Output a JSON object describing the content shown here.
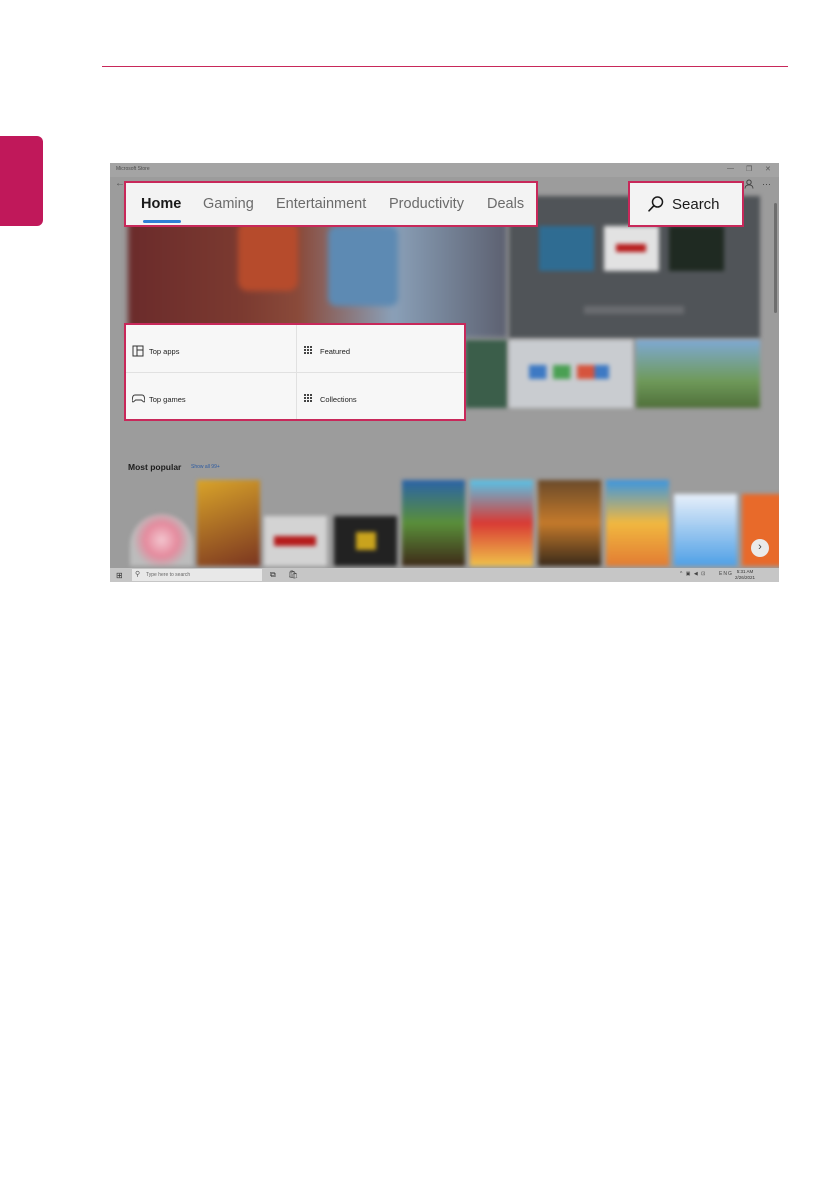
{
  "window": {
    "title": "Microsoft Store",
    "controls": [
      "—",
      "❐",
      "✕"
    ]
  },
  "nav": {
    "back": "←",
    "tabs": [
      {
        "label": "Home",
        "active": true
      },
      {
        "label": "Gaming"
      },
      {
        "label": "Entertainment"
      },
      {
        "label": "Productivity"
      },
      {
        "label": "Deals"
      }
    ],
    "search_label": "Search",
    "account_icon": "person-icon",
    "more_icon": "⋯"
  },
  "categories": {
    "top_apps": "Top apps",
    "featured": "Featured",
    "top_games": "Top games",
    "collections": "Collections"
  },
  "most_popular": {
    "title": "Most popular",
    "show_all": "Show all 99+",
    "next": "›"
  },
  "taskbar": {
    "search_placeholder": "Type here to search",
    "time": "5:31 AM",
    "date": "2/26/2021",
    "lang": "ENG",
    "tray": "^ ▣ ◀ ⊡"
  },
  "colors": {
    "highlight": "#c8285a",
    "accent": "#2f7fd6",
    "side_tab": "#c0185a"
  }
}
